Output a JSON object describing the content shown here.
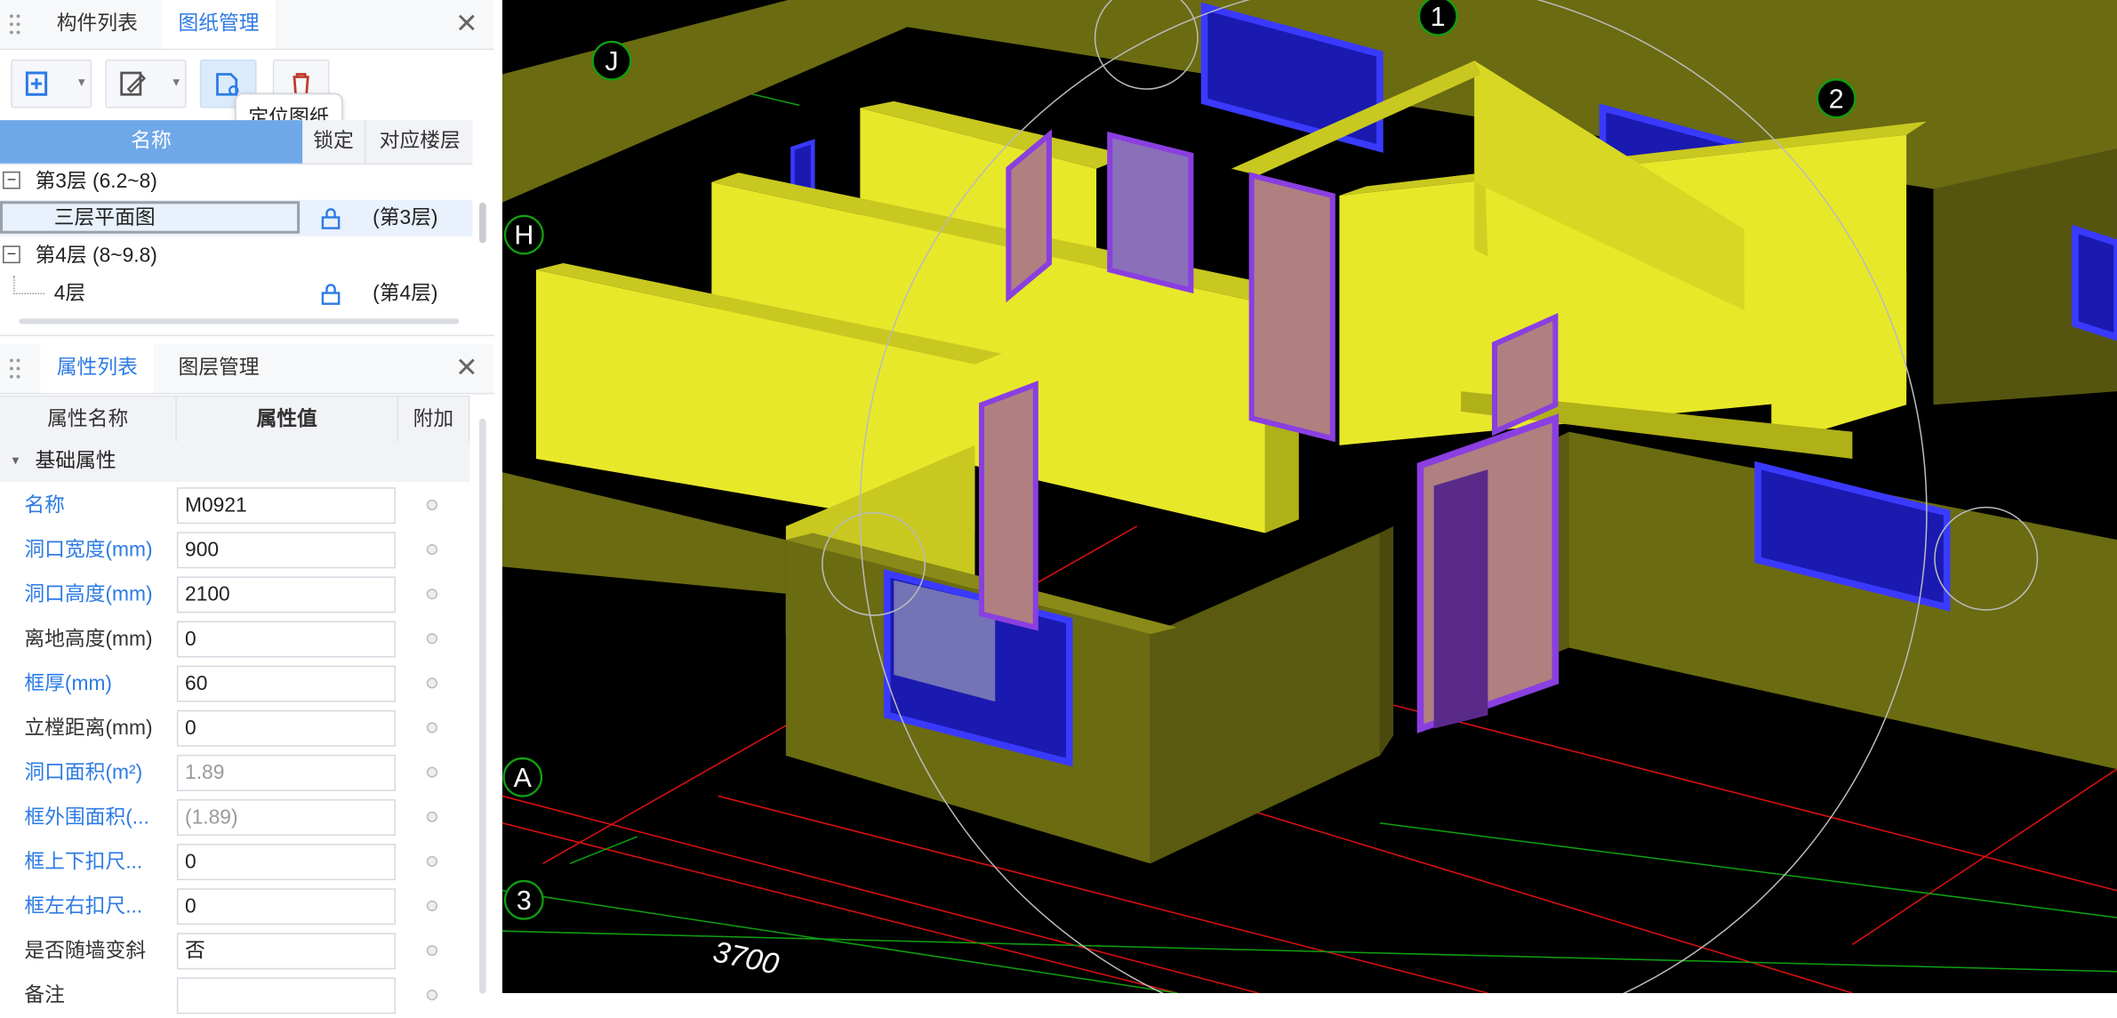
{
  "drawing_panel": {
    "tabs": [
      "构件列表",
      "图纸管理"
    ],
    "active_tab": "图纸管理",
    "tooltip": "定位图纸",
    "columns": {
      "name": "名称",
      "lock": "锁定",
      "floor": "对应楼层"
    },
    "floors": [
      {
        "label": "第3层 (6.2~8)",
        "drawing": "三层平面图",
        "mapped_floor": "(第3层)",
        "selected": true
      },
      {
        "label": "第4层 (8~9.8)",
        "drawing": "4层",
        "mapped_floor": "(第4层)",
        "selected": false
      }
    ]
  },
  "property_panel": {
    "tabs": [
      "属性列表",
      "图层管理"
    ],
    "active_tab": "属性列表",
    "columns": {
      "name": "属性名称",
      "value": "属性值",
      "extra": "附加"
    },
    "group": "基础属性",
    "rows": [
      {
        "label": "名称",
        "value": "M0921",
        "style": "blue"
      },
      {
        "label": "洞口宽度(mm)",
        "value": "900",
        "style": "blue"
      },
      {
        "label": "洞口高度(mm)",
        "value": "2100",
        "style": "blue"
      },
      {
        "label": "离地高度(mm)",
        "value": "0",
        "style": "dark"
      },
      {
        "label": "框厚(mm)",
        "value": "60",
        "style": "blue"
      },
      {
        "label": "立樘距离(mm)",
        "value": "0",
        "style": "dark"
      },
      {
        "label": "洞口面积(m²)",
        "value": "1.89",
        "style": "blue",
        "readonly": true
      },
      {
        "label": "框外围面积(...",
        "value": "(1.89)",
        "style": "blue",
        "readonly": true
      },
      {
        "label": "框上下扣尺...",
        "value": "0",
        "style": "blue"
      },
      {
        "label": "框左右扣尺...",
        "value": "0",
        "style": "blue"
      },
      {
        "label": "是否随墙变斜",
        "value": "否",
        "style": "dark"
      },
      {
        "label": "备注",
        "value": "",
        "style": "dark"
      }
    ]
  },
  "viewport": {
    "axis_labels": {
      "J": "J",
      "H": "H",
      "A": "A",
      "1": "1",
      "2": "2",
      "3": "3"
    },
    "dimension": "3700",
    "colors": {
      "background": "#000000",
      "wall_outer": "#6b6b12",
      "wall_inner": "#e8e82a",
      "door_frame": "#8a3fe0",
      "door_panel": "#b08080",
      "window": "#1a1ab0",
      "grid_red": "#e01010",
      "grid_green": "#10a010"
    }
  }
}
